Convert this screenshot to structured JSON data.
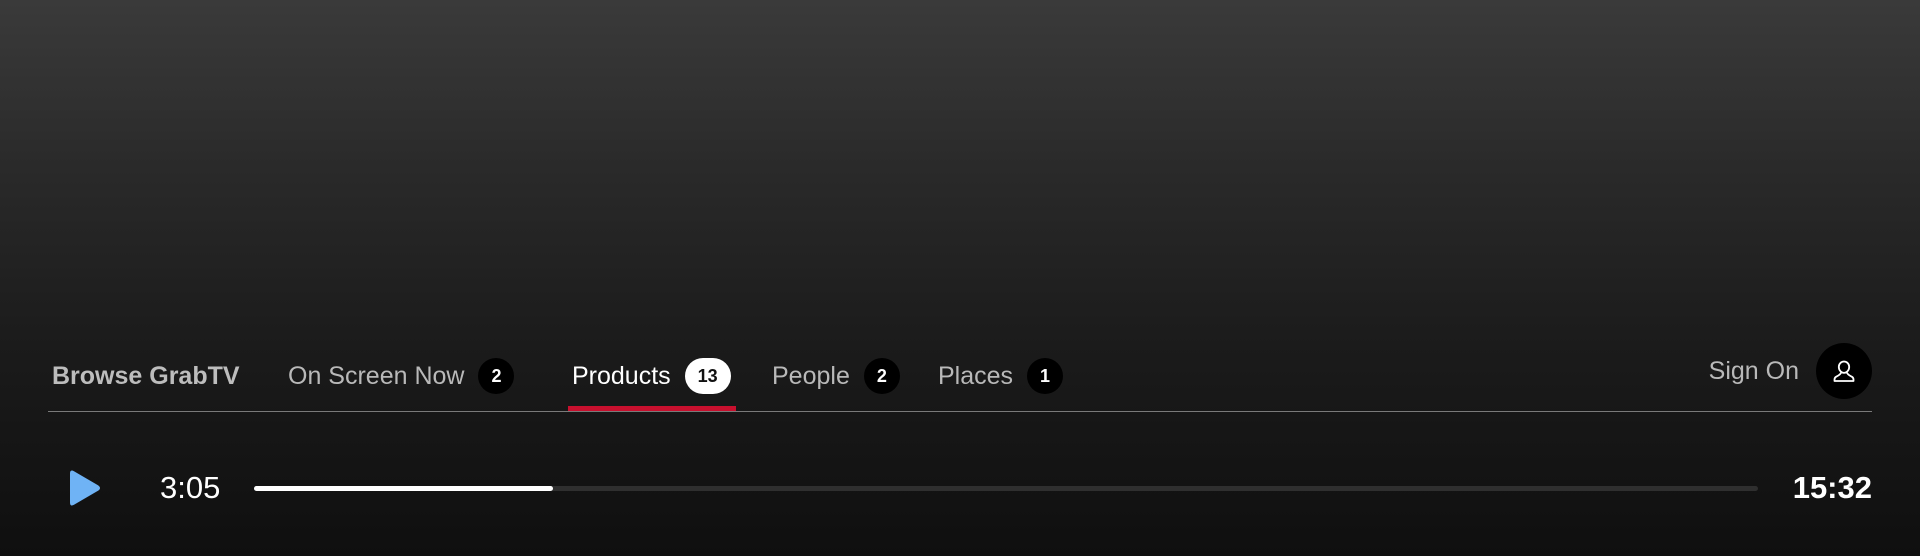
{
  "nav": {
    "browse_label": "Browse GrabTV",
    "tabs": [
      {
        "label": "On Screen Now",
        "count": "2",
        "active": false
      },
      {
        "label": "Products",
        "count": "13",
        "active": true
      },
      {
        "label": "People",
        "count": "2",
        "active": false
      },
      {
        "label": "Places",
        "count": "1",
        "active": false
      }
    ],
    "sign_on_label": "Sign On",
    "sign_on_icon": "user-icon",
    "active_color": "#c8102e"
  },
  "player": {
    "play_icon": "play-icon",
    "play_icon_color": "#6fb3f5",
    "current_time": "3:05",
    "total_time": "15:32",
    "progress_fraction": 0.199
  }
}
